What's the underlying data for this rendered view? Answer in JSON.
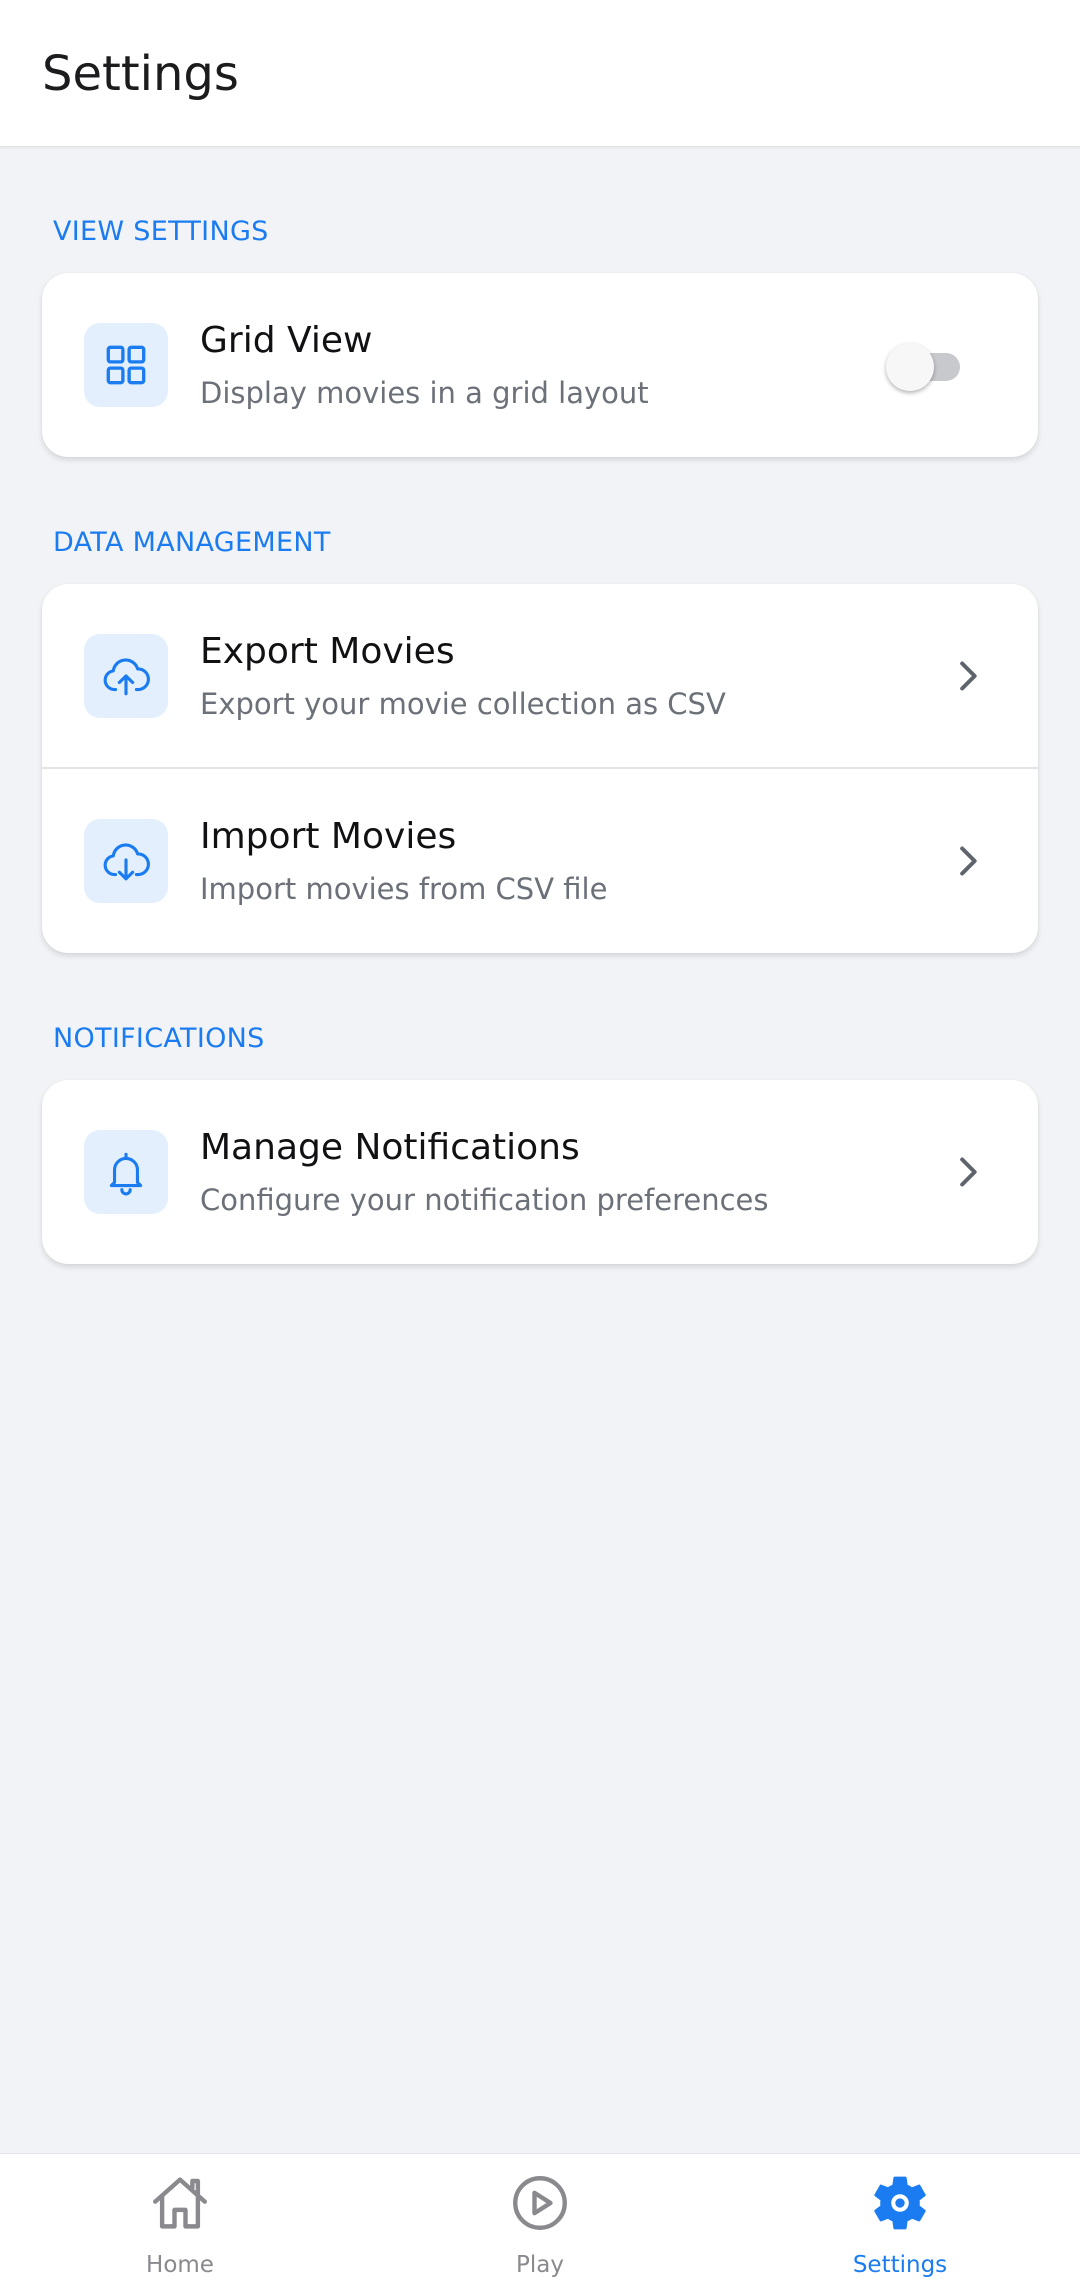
{
  "header": {
    "title": "Settings"
  },
  "sections": {
    "view": {
      "label": "VIEW SETTINGS",
      "grid_view": {
        "title": "Grid View",
        "subtitle": "Display movies in a grid layout",
        "icon": "grid-icon",
        "enabled": false
      }
    },
    "data": {
      "label": "DATA MANAGEMENT",
      "export": {
        "title": "Export Movies",
        "subtitle": "Export your movie collection as CSV",
        "icon": "cloud-upload-icon"
      },
      "import": {
        "title": "Import Movies",
        "subtitle": "Import movies from CSV file",
        "icon": "cloud-download-icon"
      }
    },
    "notifications": {
      "label": "NOTIFICATIONS",
      "manage": {
        "title": "Manage Notifications",
        "subtitle": "Configure your notification preferences",
        "icon": "bell-icon"
      }
    }
  },
  "bottom_nav": {
    "items": [
      {
        "label": "Home",
        "icon": "home-icon",
        "active": false
      },
      {
        "label": "Play",
        "icon": "play-circle-icon",
        "active": false
      },
      {
        "label": "Settings",
        "icon": "gear-icon",
        "active": true
      }
    ]
  },
  "colors": {
    "accent": "#1a7cf0",
    "icon_bg": "#e3effd",
    "inactive_nav": "#8a8a8e",
    "background": "#f2f3f6"
  }
}
